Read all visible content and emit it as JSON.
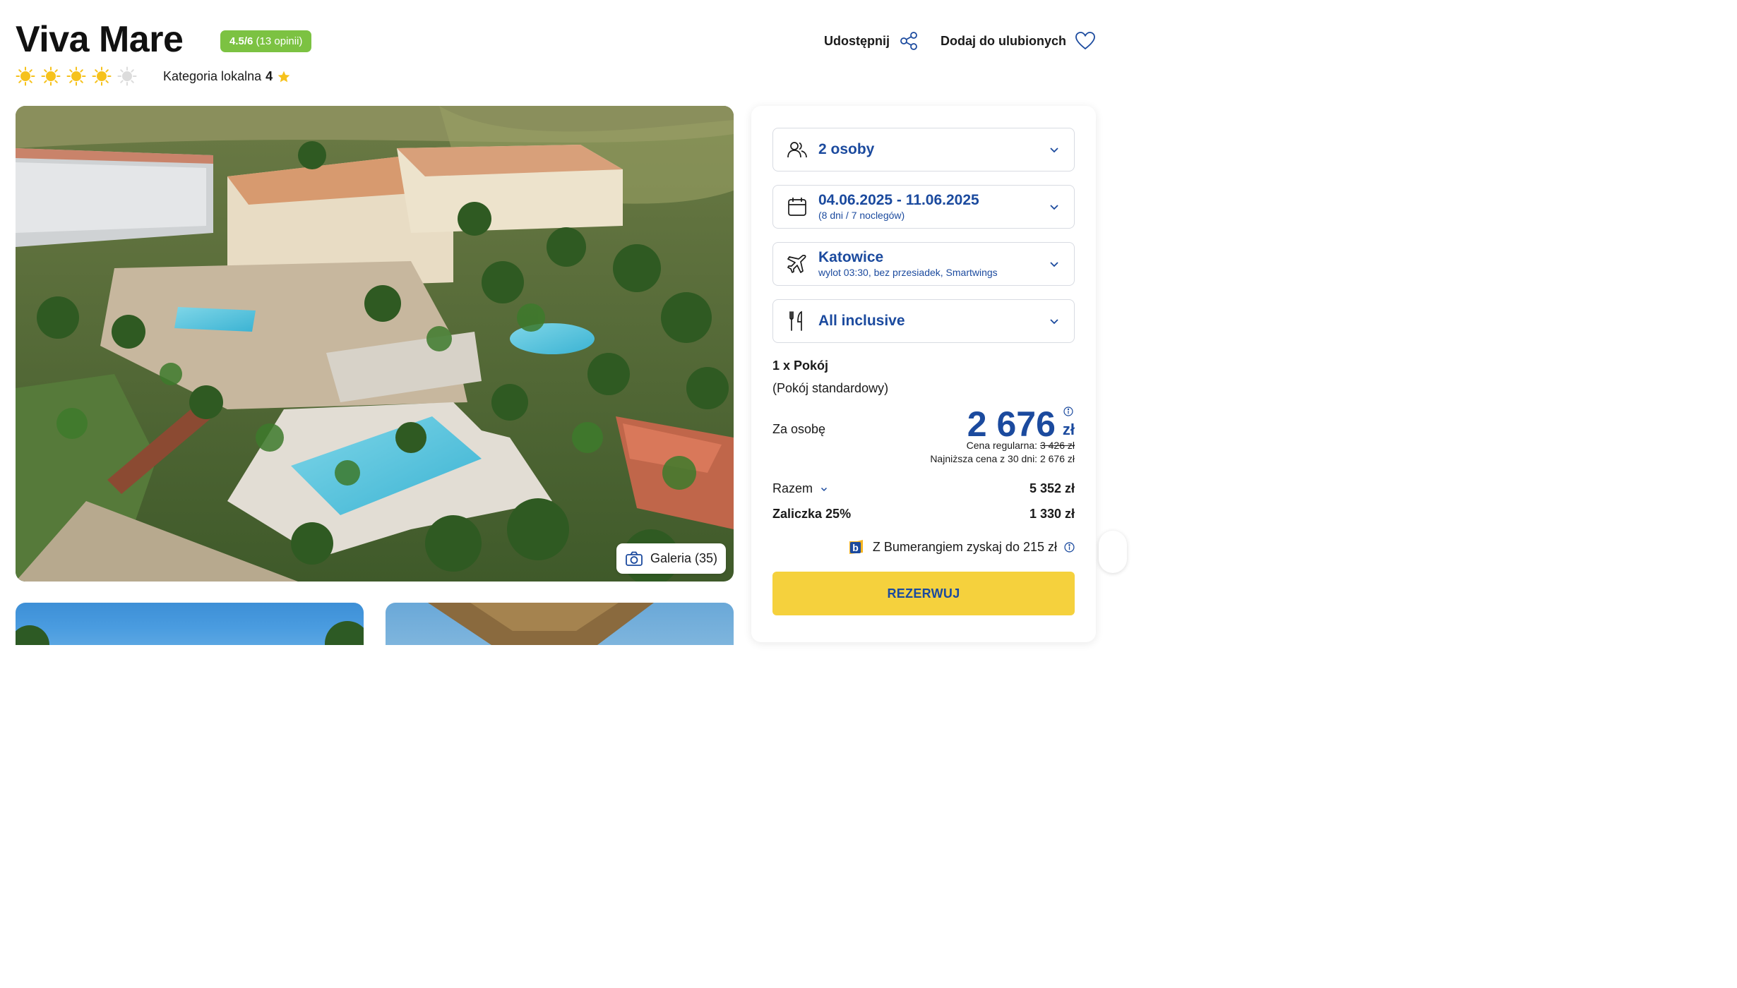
{
  "hotel": {
    "name": "Viva Mare",
    "rating_score": "4.5/6",
    "rating_count": "(13 opinii)",
    "sun_rating_filled": 4,
    "sun_rating_max": 5,
    "local_category_label": "Kategoria lokalna",
    "local_category_value": "4"
  },
  "actions": {
    "share_label": "Udostępnij",
    "favorite_label": "Dodaj do ulubionych"
  },
  "gallery": {
    "button_label": "Galeria (35)",
    "icon": "camera-icon"
  },
  "booking": {
    "persons": {
      "icon": "people-icon",
      "value": "2 osoby"
    },
    "dates": {
      "icon": "calendar-icon",
      "value": "04.06.2025 - 11.06.2025",
      "sub": "(8 dni / 7 noclegów)"
    },
    "flight": {
      "icon": "plane-icon",
      "value": "Katowice",
      "sub": "wylot 03:30, bez przesiadek, Smartwings"
    },
    "board": {
      "icon": "cutlery-icon",
      "value": "All inclusive"
    },
    "room_title": "1 x Pokój",
    "room_type": "(Pokój standardowy)",
    "per_person_label": "Za osobę",
    "price_per_person": "2 676",
    "currency": "zł",
    "regular_price_label": "Cena regularna:",
    "regular_price": "3 426 zł",
    "lowest_price_text": "Najniższa cena z 30 dni: 2 676 zł",
    "total_label": "Razem",
    "total_value": "5 352 zł",
    "deposit_label": "Zaliczka 25%",
    "deposit_value": "1 330 zł",
    "bumerang_text": "Z Bumerangiem zyskaj do 215 zł",
    "reserve_label": "REZERWUJ"
  },
  "colors": {
    "brand_blue": "#1b4a9e",
    "rating_green": "#7cc242",
    "reserve_yellow": "#f5d13d",
    "sun_yellow": "#f6c21c"
  }
}
